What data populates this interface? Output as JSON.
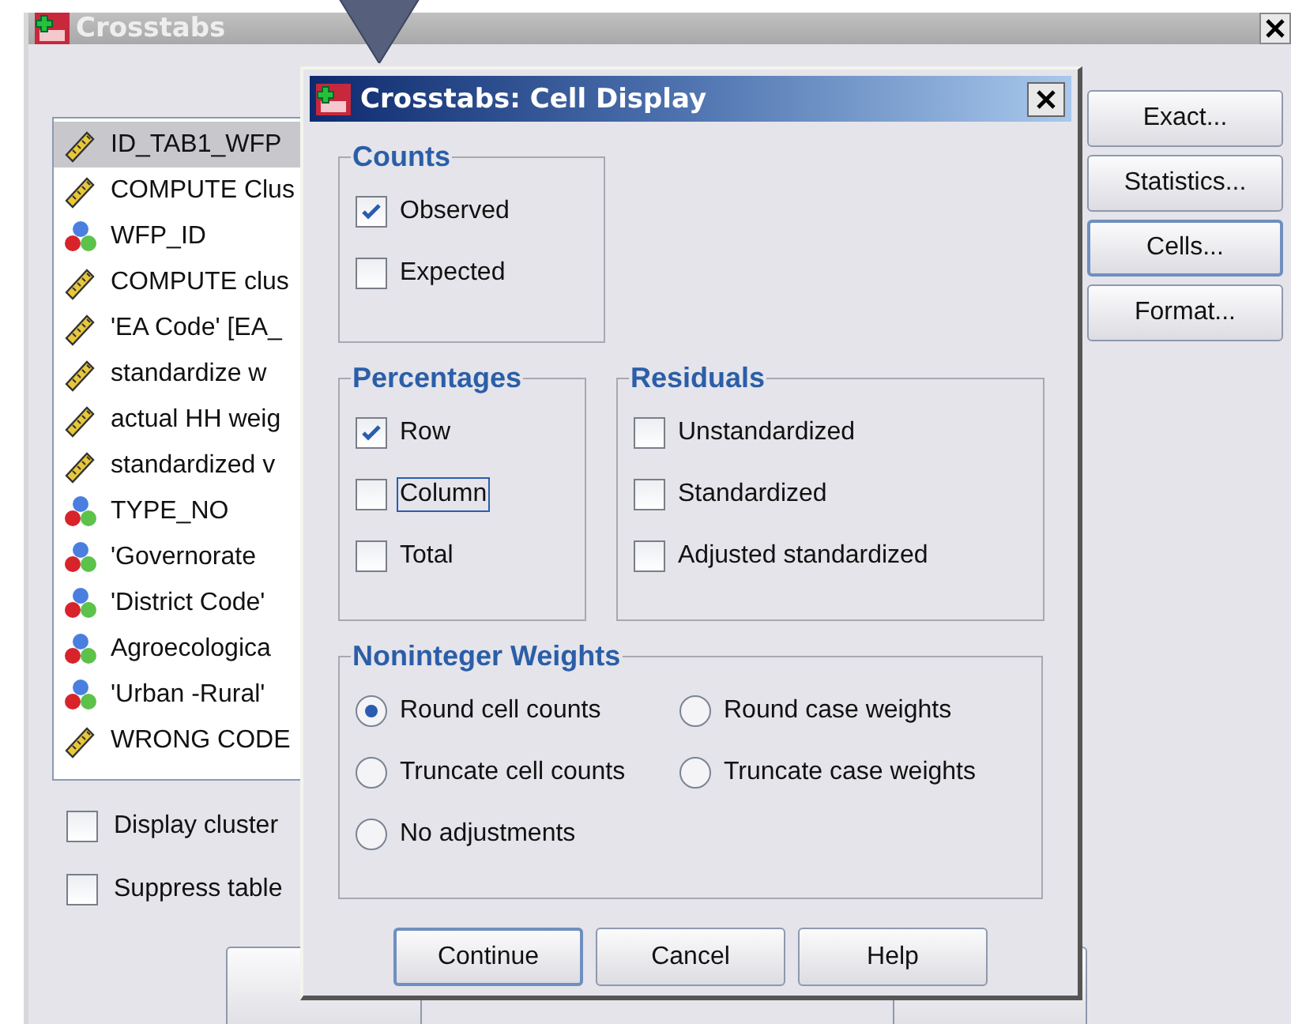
{
  "main_window": {
    "title": "Crosstabs",
    "variables": [
      {
        "kind": "scale",
        "label": "ID_TAB1_WFP",
        "selected": true
      },
      {
        "kind": "scale",
        "label": "COMPUTE Clus",
        "selected": false
      },
      {
        "kind": "nominal",
        "label": "WFP_ID",
        "selected": false
      },
      {
        "kind": "scale",
        "label": "COMPUTE clus",
        "selected": false
      },
      {
        "kind": "scale",
        "label": "'EA Code' [EA_",
        "selected": false
      },
      {
        "kind": "scale",
        "label": "standardize w",
        "selected": false
      },
      {
        "kind": "scale",
        "label": "actual HH weig",
        "selected": false
      },
      {
        "kind": "scale",
        "label": "standardized v",
        "selected": false
      },
      {
        "kind": "nominal",
        "label": "TYPE_NO",
        "selected": false
      },
      {
        "kind": "nominal",
        "label": "'Governorate",
        "selected": false
      },
      {
        "kind": "nominal",
        "label": "'District Code'",
        "selected": false
      },
      {
        "kind": "nominal",
        "label": "Agroecologica",
        "selected": false
      },
      {
        "kind": "nominal",
        "label": "'Urban -Rural'",
        "selected": false
      },
      {
        "kind": "scale",
        "label": "WRONG CODE",
        "selected": false
      }
    ],
    "options": [
      {
        "label": "Display cluster",
        "checked": false
      },
      {
        "label": "Suppress table",
        "checked": false
      }
    ],
    "side_buttons": [
      {
        "label": "Exact...",
        "focused": false
      },
      {
        "label": "Statistics...",
        "focused": false
      },
      {
        "label": "Cells...",
        "focused": true
      },
      {
        "label": "Format..."
      }
    ]
  },
  "dialog": {
    "title": "Crosstabs: Cell Display",
    "counts": {
      "title": "Counts",
      "items": [
        {
          "label": "Observed",
          "checked": true
        },
        {
          "label": "Expected",
          "checked": false
        }
      ]
    },
    "percentages": {
      "title": "Percentages",
      "items": [
        {
          "label": "Row",
          "checked": true,
          "focused": false
        },
        {
          "label": "Column",
          "checked": false,
          "focused": true
        },
        {
          "label": "Total",
          "checked": false,
          "focused": false
        }
      ]
    },
    "residuals": {
      "title": "Residuals",
      "items": [
        {
          "label": "Unstandardized",
          "checked": false
        },
        {
          "label": "Standardized",
          "checked": false
        },
        {
          "label": "Adjusted standardized",
          "checked": false
        }
      ]
    },
    "weights": {
      "title": "Noninteger Weights",
      "options": [
        {
          "label": "Round cell counts",
          "selected": true
        },
        {
          "label": "Round case weights",
          "selected": false
        },
        {
          "label": "Truncate cell counts",
          "selected": false
        },
        {
          "label": "Truncate case weights",
          "selected": false
        },
        {
          "label": "No adjustments",
          "selected": false
        }
      ]
    },
    "buttons": [
      {
        "label": "Continue",
        "default": true
      },
      {
        "label": "Cancel",
        "default": false
      },
      {
        "label": "Help",
        "default": false
      }
    ]
  }
}
